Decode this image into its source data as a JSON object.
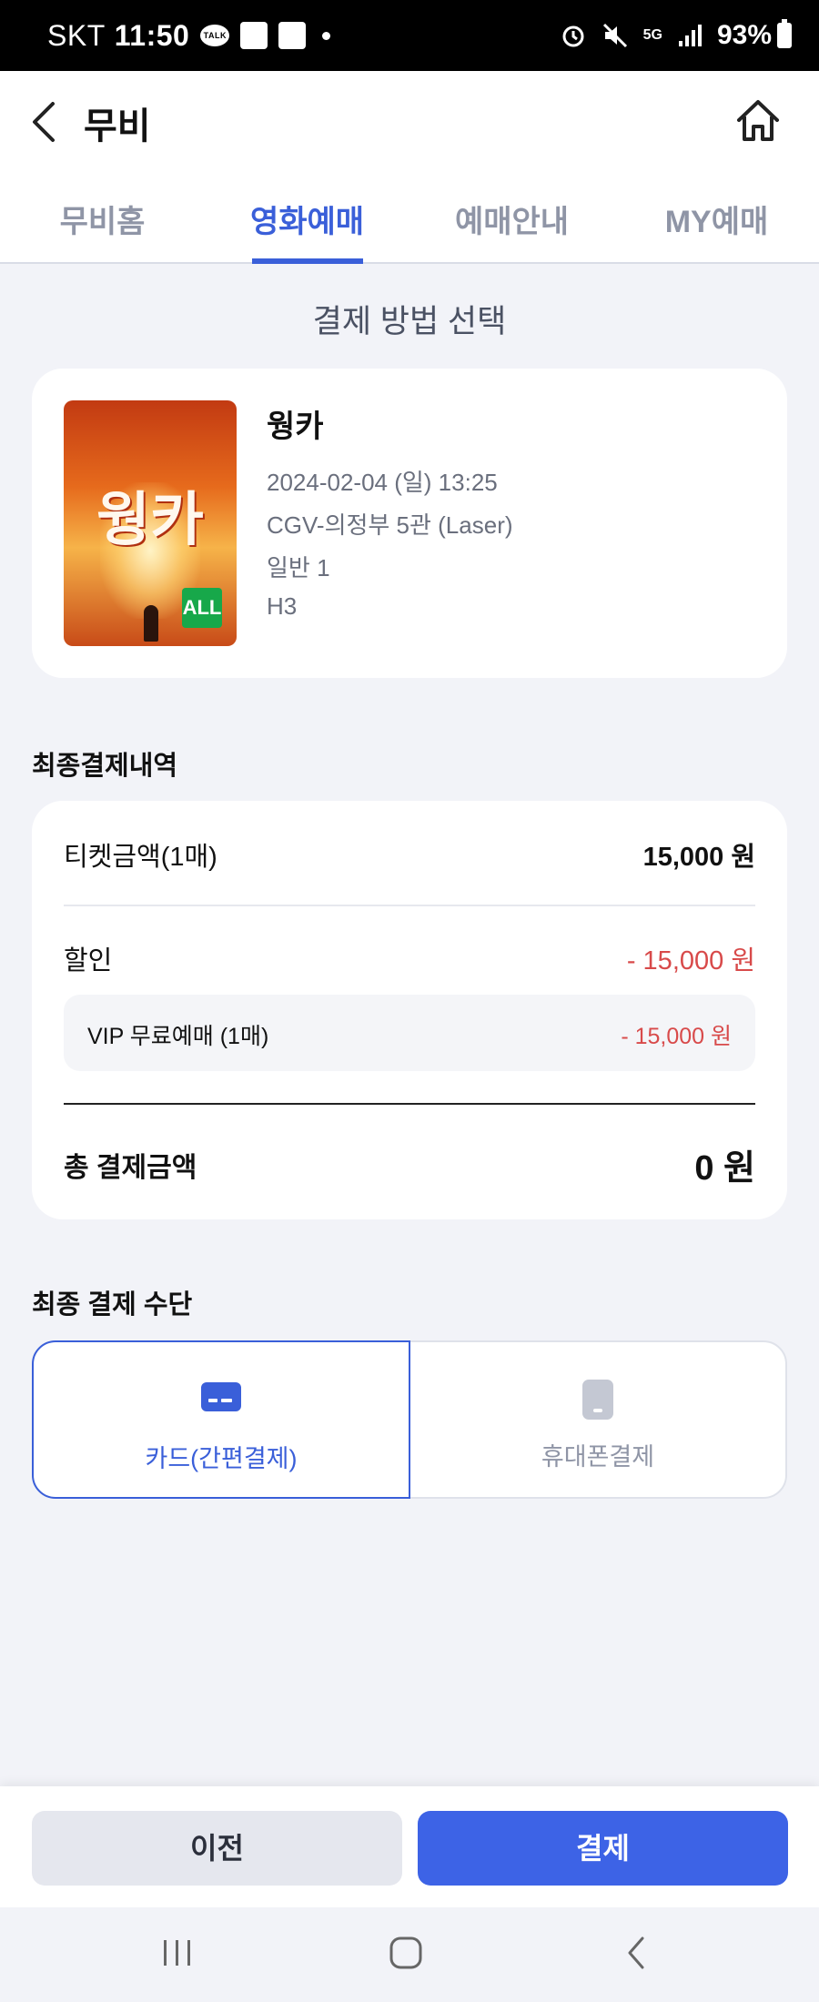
{
  "status_bar": {
    "carrier": "SKT",
    "time": "11:50",
    "network": "5G",
    "battery": "93%"
  },
  "header": {
    "title": "무비"
  },
  "tabs": [
    {
      "label": "무비홈",
      "active": false
    },
    {
      "label": "영화예매",
      "active": true
    },
    {
      "label": "예매안내",
      "active": false
    },
    {
      "label": "MY예매",
      "active": false
    }
  ],
  "page": {
    "heading": "결제 방법 선택"
  },
  "movie": {
    "poster_text": "웡카",
    "rating": "ALL",
    "title": "웡카",
    "datetime": "2024-02-04 (일) 13:25",
    "theater": "CGV-의정부 5관 (Laser)",
    "ticket": "일반 1",
    "seat": "H3"
  },
  "summary": {
    "heading": "최종결제내역",
    "ticket_label": "티켓금액(1매)",
    "ticket_value": "15,000 원",
    "discount_label": "할인",
    "discount_value": "- 15,000 원",
    "vip_label": "VIP 무료예매 (1매)",
    "vip_value": "- 15,000 원",
    "total_label": "총 결제금액",
    "total_value": "0 원"
  },
  "payment": {
    "heading": "최종 결제 수단",
    "methods": [
      {
        "label": "카드(간편결제)",
        "icon": "card-icon",
        "selected": true
      },
      {
        "label": "휴대폰결제",
        "icon": "phone-icon",
        "selected": false
      }
    ]
  },
  "actions": {
    "prev_label": "이전",
    "pay_label": "결제"
  },
  "colors": {
    "accent": "#3a5fd9",
    "primary_button": "#3d63e6",
    "discount": "#d84a4a"
  }
}
